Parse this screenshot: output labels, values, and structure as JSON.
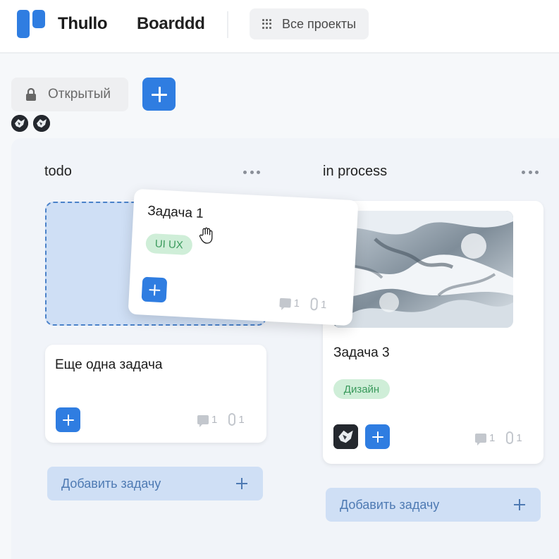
{
  "header": {
    "app_name": "Thullo",
    "board_name": "Boarddd",
    "all_projects_label": "Все проекты"
  },
  "toolbar": {
    "visibility_label": "Открытый"
  },
  "colors": {
    "accent": "#2f7de1",
    "add_task_bg": "#cfdff5",
    "tag_bg": "#cfeed8",
    "tag_text": "#3a9a5c"
  },
  "columns": [
    {
      "title": "todo",
      "add_task_label": "Добавить задачу",
      "cards": [
        {
          "title": "Еще одна задача",
          "comments": "1",
          "attachments": "1"
        }
      ]
    },
    {
      "title": "in process",
      "add_task_label": "Добавить задачу",
      "cards": [
        {
          "title": "Задача 3",
          "tag": "Дизайн",
          "comments": "1",
          "attachments": "1"
        }
      ]
    }
  ],
  "dragged_card": {
    "title": "Задача 1",
    "tag": "UI UX",
    "comments": "1",
    "attachments": "1"
  }
}
